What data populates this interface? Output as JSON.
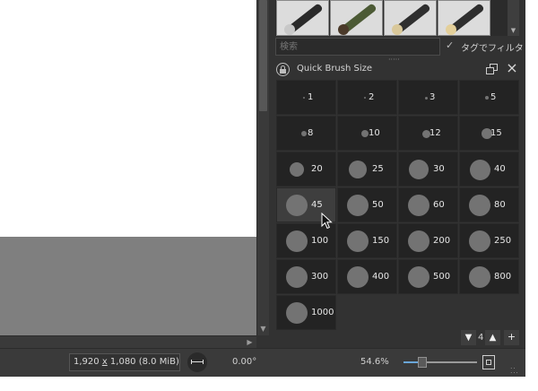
{
  "brush_presets": {
    "items": [
      {
        "name": "preset-1",
        "handle": "#2a2a2a",
        "tip": "#c8c8c8"
      },
      {
        "name": "preset-2",
        "handle": "#4c5a35",
        "tip": "#4b3a2a"
      },
      {
        "name": "preset-3",
        "handle": "#2f2f2f",
        "tip": "#d9c89a"
      },
      {
        "name": "preset-4",
        "handle": "#2e2e2e",
        "tip": "#e3cf9a"
      }
    ],
    "search_placeholder": "検索",
    "tag_filter_label": "タグでフィルタ",
    "tag_filter_checked": true
  },
  "panel": {
    "title": "Quick Brush Size"
  },
  "sizes": [
    {
      "label": "1",
      "dot": 2
    },
    {
      "label": "2",
      "dot": 2
    },
    {
      "label": "3",
      "dot": 3
    },
    {
      "label": "5",
      "dot": 4
    },
    {
      "label": "8",
      "dot": 6
    },
    {
      "label": "10",
      "dot": 8
    },
    {
      "label": "12",
      "dot": 9
    },
    {
      "label": "15",
      "dot": 12
    },
    {
      "label": "20",
      "dot": 16
    },
    {
      "label": "25",
      "dot": 20
    },
    {
      "label": "30",
      "dot": 22
    },
    {
      "label": "40",
      "dot": 23
    },
    {
      "label": "45",
      "dot": 24,
      "hover": true
    },
    {
      "label": "50",
      "dot": 24
    },
    {
      "label": "60",
      "dot": 24
    },
    {
      "label": "80",
      "dot": 24
    },
    {
      "label": "100",
      "dot": 24
    },
    {
      "label": "150",
      "dot": 24
    },
    {
      "label": "200",
      "dot": 24
    },
    {
      "label": "250",
      "dot": 24
    },
    {
      "label": "300",
      "dot": 24
    },
    {
      "label": "400",
      "dot": 24
    },
    {
      "label": "500",
      "dot": 24
    },
    {
      "label": "800",
      "dot": 24
    },
    {
      "label": "1000",
      "dot": 24
    }
  ],
  "grid_controls": {
    "down_label": "▼",
    "count": "4",
    "up_label": "▲",
    "add_label": "+"
  },
  "status": {
    "image_size_w": "1,920 ",
    "image_size_x": "x",
    "image_size_rest": " 1,080 (8.0 MiB)",
    "rotation": "0.00°",
    "zoom": "54.6%",
    "zoom_fraction": 0.22
  },
  "colors": {
    "panel_bg": "#323232",
    "cell_bg": "#232323",
    "cell_hover_bg": "#3e3e3e",
    "dot": "#737373",
    "zoom_accent": "#6aa6d8"
  }
}
